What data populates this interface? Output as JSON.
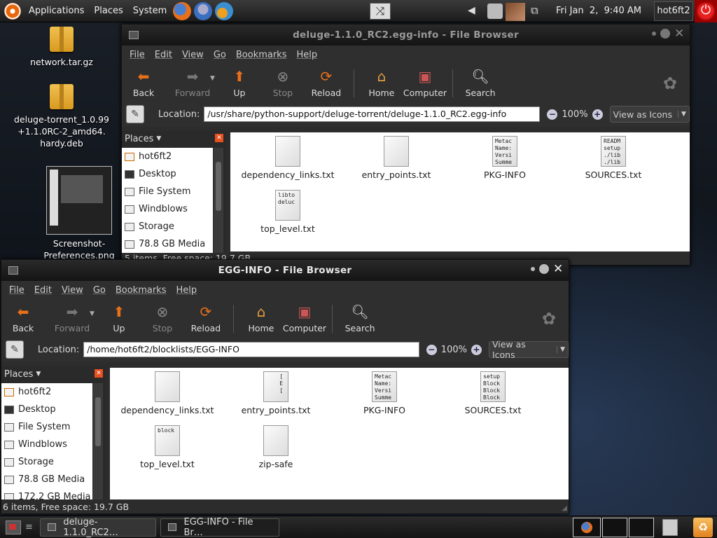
{
  "top_panel": {
    "menus": [
      "Applications",
      "Places",
      "System"
    ],
    "clock": "Fri Jan  2,  9:40 AM",
    "user": "hot6ft2"
  },
  "desktop_icons": [
    {
      "label": "network.tar.gz"
    },
    {
      "label": "deluge-torrent_1.0.99\n+1.1.0RC-2_amd64.\nhardy.deb"
    },
    {
      "label": "Screenshot-\nPreferences.png"
    }
  ],
  "window_back": {
    "title": "deluge-1.1.0_RC2.egg-info - File Browser",
    "location": "/usr/share/python-support/deluge-torrent/deluge-1.1.0_RC2.egg-info",
    "zoom": "100%",
    "view": "View as Icons",
    "status": "5 items, Free space: 19.7 GB",
    "places": [
      "hot6ft2",
      "Desktop",
      "File System",
      "Windblows",
      "Storage",
      "78.8 GB Media"
    ],
    "files": [
      {
        "name": "dependency_links.txt",
        "preview": ""
      },
      {
        "name": "entry_points.txt",
        "preview": ""
      },
      {
        "name": "PKG-INFO",
        "preview": "Metac\nName:\nVersi\nSumme"
      },
      {
        "name": "SOURCES.txt",
        "preview": "READM\nsetup\n./lib\n./lib"
      },
      {
        "name": "top_level.txt",
        "preview": "libto\ndeluc"
      }
    ]
  },
  "window_front": {
    "title": "EGG-INFO - File Browser",
    "location": "/home/hot6ft2/blocklists/EGG-INFO",
    "zoom": "100%",
    "view": "View as Icons",
    "status": "6 items, Free space: 19.7 GB",
    "places": [
      "hot6ft2",
      "Desktop",
      "File System",
      "Windblows",
      "Storage",
      "78.8 GB Media",
      "172.2 GB Media"
    ],
    "files": [
      {
        "name": "dependency_links.txt",
        "preview": ""
      },
      {
        "name": "entry_points.txt",
        "preview": "    [\n    E\n    ["
      },
      {
        "name": "PKG-INFO",
        "preview": "Metac\nName:\nVersi\nSumme"
      },
      {
        "name": "SOURCES.txt",
        "preview": "setup\nBlock\nBlock\nBlock"
      },
      {
        "name": "top_level.txt",
        "preview": "block"
      },
      {
        "name": "zip-safe",
        "preview": ""
      }
    ]
  },
  "common": {
    "menubar": [
      "File",
      "Edit",
      "View",
      "Go",
      "Bookmarks",
      "Help"
    ],
    "toolbar": {
      "back": "Back",
      "forward": "Forward",
      "up": "Up",
      "stop": "Stop",
      "reload": "Reload",
      "home": "Home",
      "computer": "Computer",
      "search": "Search"
    },
    "location_label": "Location:",
    "places_label": "Places"
  },
  "taskbar": [
    {
      "label": "deluge-1.1.0_RC2…"
    },
    {
      "label": "EGG-INFO - File Br…"
    }
  ],
  "colors": {
    "accent_orange": "#e86a1a",
    "panel_dark": "#1c1c1c",
    "power_red": "#d01010"
  }
}
